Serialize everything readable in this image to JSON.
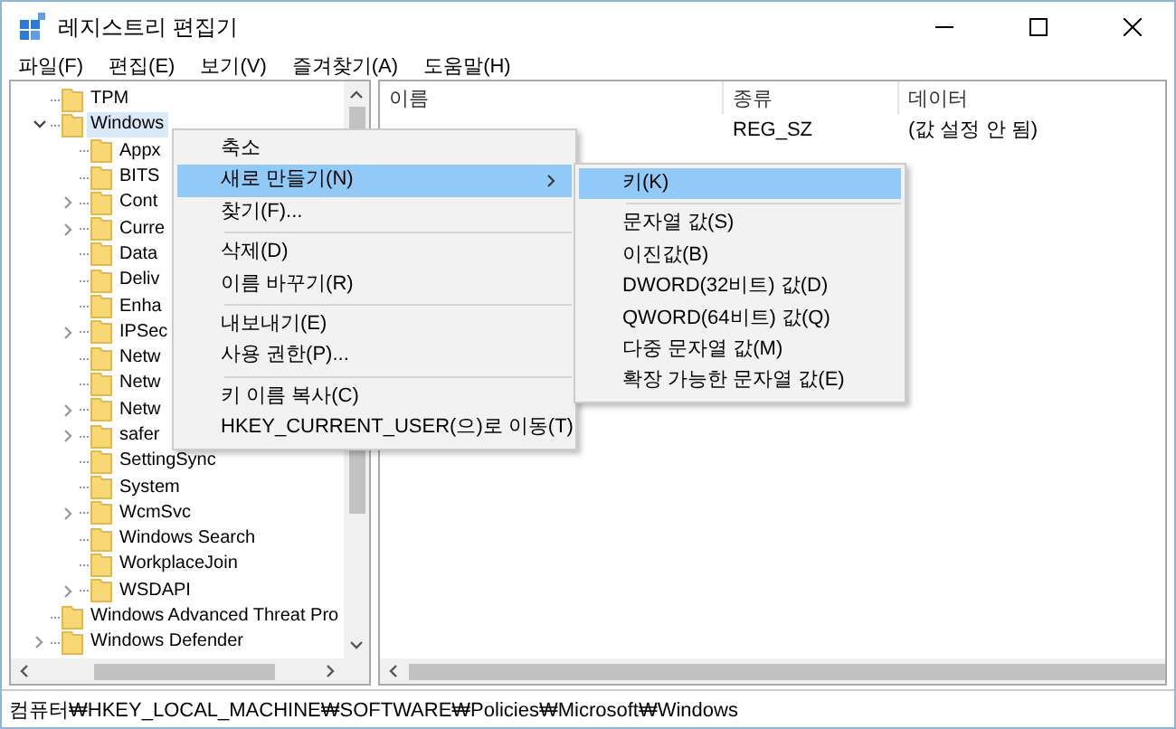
{
  "window": {
    "title": "레지스트리 편집기"
  },
  "menu_bar": [
    "파일(F)",
    "편집(E)",
    "보기(V)",
    "즐겨찾기(A)",
    "도움말(H)"
  ],
  "tree": [
    {
      "label": "TPM",
      "kind": "leaf",
      "selected": false
    },
    {
      "label": "Windows",
      "kind": "branch",
      "expanded": true,
      "selected": true,
      "children": [
        {
          "label": "Appx",
          "kind": "leaf",
          "selected": false
        },
        {
          "label": "BITS",
          "kind": "leaf",
          "selected": false
        },
        {
          "label": "Cont",
          "kind": "branch",
          "expanded": false,
          "selected": false
        },
        {
          "label": "Curre",
          "kind": "branch",
          "expanded": false,
          "selected": false
        },
        {
          "label": "Data",
          "kind": "leaf",
          "selected": false
        },
        {
          "label": "Deliv",
          "kind": "leaf",
          "selected": false
        },
        {
          "label": "Enha",
          "kind": "leaf",
          "selected": false
        },
        {
          "label": "IPSec",
          "kind": "branch",
          "expanded": false,
          "selected": false
        },
        {
          "label": "Netw",
          "kind": "leaf",
          "selected": false
        },
        {
          "label": "Netw",
          "kind": "leaf",
          "selected": false
        },
        {
          "label": "Netw",
          "kind": "branch",
          "expanded": false,
          "selected": false
        },
        {
          "label": "safer",
          "kind": "branch",
          "expanded": false,
          "selected": false
        },
        {
          "label": "SettingSync",
          "kind": "leaf",
          "selected": false
        },
        {
          "label": "System",
          "kind": "leaf",
          "selected": false
        },
        {
          "label": "WcmSvc",
          "kind": "branch",
          "expanded": false,
          "selected": false
        },
        {
          "label": "Windows Search",
          "kind": "leaf",
          "selected": false
        },
        {
          "label": "WorkplaceJoin",
          "kind": "leaf",
          "selected": false
        },
        {
          "label": "WSDAPI",
          "kind": "branch",
          "expanded": false,
          "selected": false
        }
      ]
    },
    {
      "label": "Windows Advanced Threat Pro",
      "kind": "leaf",
      "selected": false
    },
    {
      "label": "Windows Defender",
      "kind": "branch",
      "expanded": false,
      "selected": false
    }
  ],
  "table": {
    "columns": [
      "이름",
      "종류",
      "데이터"
    ],
    "rows": [
      {
        "type": "REG_SZ",
        "data": "(값 설정 안 됨)"
      }
    ]
  },
  "context_menu": {
    "items": [
      {
        "kind": "item",
        "label": "축소",
        "selected": false
      },
      {
        "kind": "submenu",
        "label": "새로 만들기(N)",
        "selected": true
      },
      {
        "kind": "item",
        "label": "찾기(F)...",
        "selected": false
      },
      {
        "kind": "separator"
      },
      {
        "kind": "item",
        "label": "삭제(D)",
        "selected": false
      },
      {
        "kind": "item",
        "label": "이름 바꾸기(R)",
        "selected": false
      },
      {
        "kind": "separator"
      },
      {
        "kind": "item",
        "label": "내보내기(E)",
        "selected": false
      },
      {
        "kind": "item",
        "label": "사용 권한(P)...",
        "selected": false
      },
      {
        "kind": "separator"
      },
      {
        "kind": "item",
        "label": "키 이름 복사(C)",
        "selected": false
      },
      {
        "kind": "item",
        "label": "HKEY_CURRENT_USER(으)로 이동(T)",
        "selected": false
      }
    ]
  },
  "submenu": {
    "items": [
      {
        "kind": "item",
        "label": "키(K)",
        "selected": true
      },
      {
        "kind": "separator"
      },
      {
        "kind": "item",
        "label": "문자열 값(S)",
        "selected": false
      },
      {
        "kind": "item",
        "label": "이진값(B)",
        "selected": false
      },
      {
        "kind": "item",
        "label": "DWORD(32비트) 값(D)",
        "selected": false
      },
      {
        "kind": "item",
        "label": "QWORD(64비트) 값(Q)",
        "selected": false
      },
      {
        "kind": "item",
        "label": "다중 문자열 값(M)",
        "selected": false
      },
      {
        "kind": "item",
        "label": "확장 가능한 문자열 값(E)",
        "selected": false
      }
    ]
  },
  "status_bar": "컴퓨터₩HKEY_LOCAL_MACHINE₩SOFTWARE₩Policies₩Microsoft₩Windows"
}
